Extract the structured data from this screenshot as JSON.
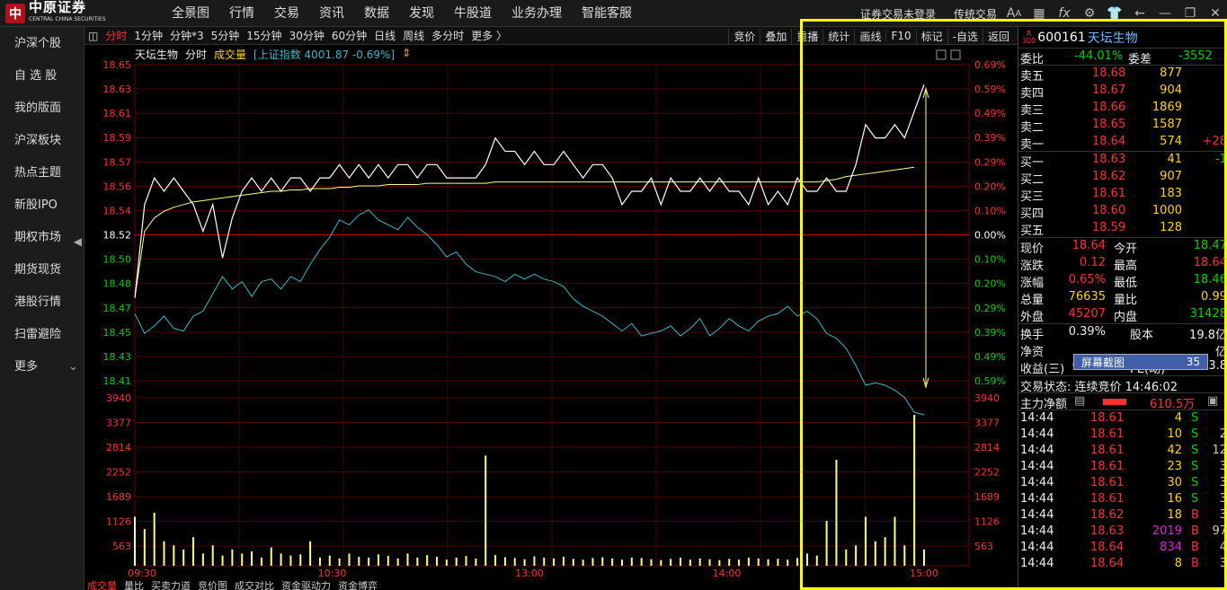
{
  "brand": {
    "name": "中原证券",
    "sub": "CENTRAL CHINA SECURITIES"
  },
  "menu": [
    "全景图",
    "行情",
    "交易",
    "资讯",
    "数据",
    "发现",
    "牛股道",
    "业务办理",
    "智能客服"
  ],
  "top_right": {
    "login_status": "证券交易未登录",
    "trade_mode": "传统交易"
  },
  "sidebar": [
    "沪深个股",
    "自 选 股",
    "我的版面",
    "沪深板块",
    "热点主题",
    "新股IPO",
    "期权市场",
    "期货现货",
    "港股行情",
    "扫雷避险",
    "更多"
  ],
  "periods": [
    "分时",
    "1分钟",
    "分钟*3",
    "5分钟",
    "15分钟",
    "30分钟",
    "60分钟",
    "日线",
    "周线",
    "多分时",
    "更多 〉"
  ],
  "period_active": "分时",
  "toolbar_right": [
    "竞价",
    "叠加",
    "重播",
    "统计",
    "画线",
    "F10",
    "标记",
    "-自选",
    "返回"
  ],
  "chart_header": {
    "name": "天坛生物",
    "mode": "分时",
    "vol_label": "成交量",
    "index_info": "[上证指数 4001.87 -0.69%]"
  },
  "colors": {
    "up": "#ff3030",
    "down": "#00d000",
    "price_line": "#ffffff",
    "avg_line": "#ffff80",
    "index_line": "#3ab8c8",
    "vol_bar": "#ffff80",
    "grid": "#6a0000"
  },
  "chart_data": {
    "type": "line",
    "price_ticks": [
      "18.65",
      "18.63",
      "18.61",
      "18.59",
      "18.57",
      "18.56",
      "18.54",
      "18.52",
      "18.50",
      "18.48",
      "18.47",
      "18.45",
      "18.43",
      "18.41"
    ],
    "pct_ticks": [
      "0.69%",
      "0.59%",
      "0.49%",
      "0.39%",
      "0.29%",
      "0.20%",
      "0.10%",
      "0.00%",
      "0.10%",
      "0.20%",
      "0.29%",
      "0.39%",
      "0.49%",
      "0.59%"
    ],
    "volume_ticks": [
      "3940",
      "3377",
      "2814",
      "2252",
      "1689",
      "1126",
      "563"
    ],
    "time_ticks": [
      "09:30",
      "10:30",
      "13:00",
      "14:00",
      "15:00"
    ],
    "prev_close": 18.52,
    "price_series": [
      18.48,
      18.55,
      18.57,
      18.56,
      18.57,
      18.56,
      18.55,
      18.53,
      18.55,
      18.51,
      18.54,
      18.56,
      18.57,
      18.56,
      18.57,
      18.56,
      18.57,
      18.57,
      18.56,
      18.57,
      18.57,
      18.58,
      18.57,
      18.58,
      18.57,
      18.58,
      18.57,
      18.58,
      18.58,
      18.57,
      18.58,
      18.58,
      18.57,
      18.57,
      18.57,
      18.57,
      18.58,
      18.6,
      18.59,
      18.59,
      18.58,
      18.59,
      18.58,
      18.58,
      18.59,
      18.58,
      18.57,
      18.58,
      18.58,
      18.57,
      18.55,
      18.56,
      18.56,
      18.57,
      18.55,
      18.57,
      18.56,
      18.56,
      18.57,
      18.56,
      18.57,
      18.56,
      18.56,
      18.55,
      18.57,
      18.55,
      18.56,
      18.55,
      18.57,
      18.56,
      18.56,
      18.57,
      18.56,
      18.56,
      18.58,
      18.61,
      18.6,
      18.6,
      18.61,
      18.6,
      18.62,
      18.64
    ],
    "avg_series": [
      18.48,
      18.53,
      18.54,
      18.545,
      18.548,
      18.55,
      18.552,
      18.553,
      18.554,
      18.555,
      18.556,
      18.557,
      18.558,
      18.559,
      18.56,
      18.56,
      18.561,
      18.561,
      18.562,
      18.562,
      18.562,
      18.563,
      18.563,
      18.564,
      18.564,
      18.564,
      18.565,
      18.565,
      18.565,
      18.565,
      18.566,
      18.566,
      18.566,
      18.566,
      18.566,
      18.566,
      18.566,
      18.567,
      18.567,
      18.567,
      18.567,
      18.567,
      18.567,
      18.567,
      18.567,
      18.567,
      18.567,
      18.567,
      18.567,
      18.567,
      18.567,
      18.567,
      18.567,
      18.567,
      18.567,
      18.567,
      18.567,
      18.567,
      18.567,
      18.567,
      18.567,
      18.567,
      18.567,
      18.567,
      18.567,
      18.567,
      18.567,
      18.567,
      18.567,
      18.567,
      18.567,
      18.568,
      18.569,
      18.571,
      18.572,
      18.573,
      18.574,
      18.575,
      18.576,
      18.577,
      18.578
    ],
    "index_pct_series": [
      -0.28,
      -0.36,
      -0.33,
      -0.29,
      -0.34,
      -0.35,
      -0.29,
      -0.27,
      -0.2,
      -0.13,
      -0.18,
      -0.15,
      -0.21,
      -0.15,
      -0.14,
      -0.18,
      -0.13,
      -0.15,
      -0.08,
      -0.02,
      0.03,
      0.1,
      0.08,
      0.12,
      0.14,
      0.1,
      0.08,
      0.06,
      0.11,
      0.07,
      0.04,
      0.0,
      -0.05,
      -0.03,
      -0.08,
      -0.11,
      -0.12,
      -0.13,
      -0.15,
      -0.12,
      -0.14,
      -0.12,
      -0.14,
      -0.15,
      -0.17,
      -0.22,
      -0.25,
      -0.27,
      -0.29,
      -0.32,
      -0.35,
      -0.32,
      -0.37,
      -0.36,
      -0.35,
      -0.33,
      -0.37,
      -0.34,
      -0.3,
      -0.37,
      -0.34,
      -0.3,
      -0.33,
      -0.35,
      -0.31,
      -0.29,
      -0.28,
      -0.25,
      -0.29,
      -0.27,
      -0.3,
      -0.36,
      -0.38,
      -0.42,
      -0.49,
      -0.57,
      -0.56,
      -0.57,
      -0.59,
      -0.62,
      -0.68,
      -0.69
    ],
    "volume_series": [
      1200,
      900,
      1300,
      600,
      500,
      400,
      700,
      300,
      500,
      250,
      400,
      300,
      350,
      200,
      450,
      300,
      250,
      280,
      600,
      200,
      250,
      180,
      300,
      220,
      200,
      280,
      240,
      180,
      300,
      200,
      260,
      220,
      150,
      200,
      240,
      180,
      2700,
      260,
      210,
      190,
      160,
      230,
      200,
      180,
      220,
      170,
      150,
      190,
      210,
      180,
      150,
      200,
      190,
      160,
      140,
      170,
      200,
      150,
      180,
      160,
      140,
      170,
      150,
      200,
      180,
      160,
      170,
      150,
      190,
      300,
      250,
      1100,
      2600,
      400,
      500,
      1200,
      600,
      700,
      1200,
      500,
      3700,
      400
    ]
  },
  "right_panel": {
    "badge_top": "R",
    "badge_bottom": "300",
    "code": "600161",
    "name": "天坛生物",
    "weibi_label": "委比",
    "weibi": "-44.01%",
    "weicha_label": "委差",
    "weicha": "-3552",
    "asks": [
      {
        "label": "卖五",
        "price": "18.68",
        "vol": "877",
        "chg": ""
      },
      {
        "label": "卖四",
        "price": "18.67",
        "vol": "904",
        "chg": ""
      },
      {
        "label": "卖三",
        "price": "18.66",
        "vol": "1869",
        "chg": ""
      },
      {
        "label": "卖二",
        "price": "18.65",
        "vol": "1587",
        "chg": ""
      },
      {
        "label": "卖一",
        "price": "18.64",
        "vol": "574",
        "chg": "+28"
      }
    ],
    "bids": [
      {
        "label": "买一",
        "price": "18.63",
        "vol": "41",
        "chg": "-1"
      },
      {
        "label": "买二",
        "price": "18.62",
        "vol": "907",
        "chg": ""
      },
      {
        "label": "买三",
        "price": "18.61",
        "vol": "183",
        "chg": ""
      },
      {
        "label": "买四",
        "price": "18.60",
        "vol": "1000",
        "chg": ""
      },
      {
        "label": "买五",
        "price": "18.59",
        "vol": "128",
        "chg": ""
      }
    ],
    "quote": [
      {
        "l1": "现价",
        "v1": "18.64",
        "c1": "red",
        "l2": "今开",
        "v2": "18.47",
        "c2": "green"
      },
      {
        "l1": "涨跌",
        "v1": "0.12",
        "c1": "red",
        "l2": "最高",
        "v2": "18.64",
        "c2": "red"
      },
      {
        "l1": "涨幅",
        "v1": "0.65%",
        "c1": "red",
        "l2": "最低",
        "v2": "18.46",
        "c2": "green"
      },
      {
        "l1": "总量",
        "v1": "76635",
        "c1": "yellow",
        "l2": "量比",
        "v2": "0.99",
        "c2": "yellow"
      },
      {
        "l1": "外盘",
        "v1": "45207",
        "c1": "red",
        "l2": "内盘",
        "v2": "31428",
        "c2": "green"
      }
    ],
    "fin": [
      {
        "l1": "换手",
        "v1": "0.39%",
        "l2": "股本",
        "v2": "19.8亿"
      },
      {
        "l1": "净资",
        "v1": "",
        "l2": "",
        "v2": "亿"
      },
      {
        "l1": "收益(三)",
        "v1": "0.410",
        "l2": "PE(动)",
        "v2": "33.8"
      }
    ],
    "screenshot_tip": {
      "label": "屏幕截图",
      "value": "35"
    },
    "trade_status": "交易状态: 连续竞价 14:46:02",
    "main_flow_label": "主力净额",
    "main_flow_value": "610.5万",
    "ticks": [
      {
        "t": "14:44",
        "p": "18.61",
        "v": "4",
        "s": "S",
        "n": "",
        "vc": "yellow"
      },
      {
        "t": "14:44",
        "p": "18.61",
        "v": "10",
        "s": "S",
        "n": "2",
        "vc": "yellow"
      },
      {
        "t": "14:44",
        "p": "18.61",
        "v": "42",
        "s": "S",
        "n": "12",
        "vc": "yellow"
      },
      {
        "t": "14:44",
        "p": "18.61",
        "v": "23",
        "s": "S",
        "n": "3",
        "vc": "yellow"
      },
      {
        "t": "14:44",
        "p": "18.61",
        "v": "30",
        "s": "S",
        "n": "3",
        "vc": "yellow"
      },
      {
        "t": "14:44",
        "p": "18.61",
        "v": "16",
        "s": "S",
        "n": "3",
        "vc": "yellow"
      },
      {
        "t": "14:44",
        "p": "18.62",
        "v": "18",
        "s": "B",
        "n": "3",
        "vc": "yellow"
      },
      {
        "t": "14:44",
        "p": "18.63",
        "v": "2019",
        "s": "B",
        "n": "97",
        "vc": "purple"
      },
      {
        "t": "14:44",
        "p": "18.64",
        "v": "834",
        "s": "B",
        "n": "4",
        "vc": "purple"
      },
      {
        "t": "14:44",
        "p": "18.64",
        "v": "8",
        "s": "B",
        "n": "3",
        "vc": "yellow"
      }
    ]
  },
  "bottom_tabs": [
    "成交量",
    "量比",
    "买卖力道",
    "竞价图",
    "成交对比",
    "资金驱动力",
    "资金博弈"
  ]
}
